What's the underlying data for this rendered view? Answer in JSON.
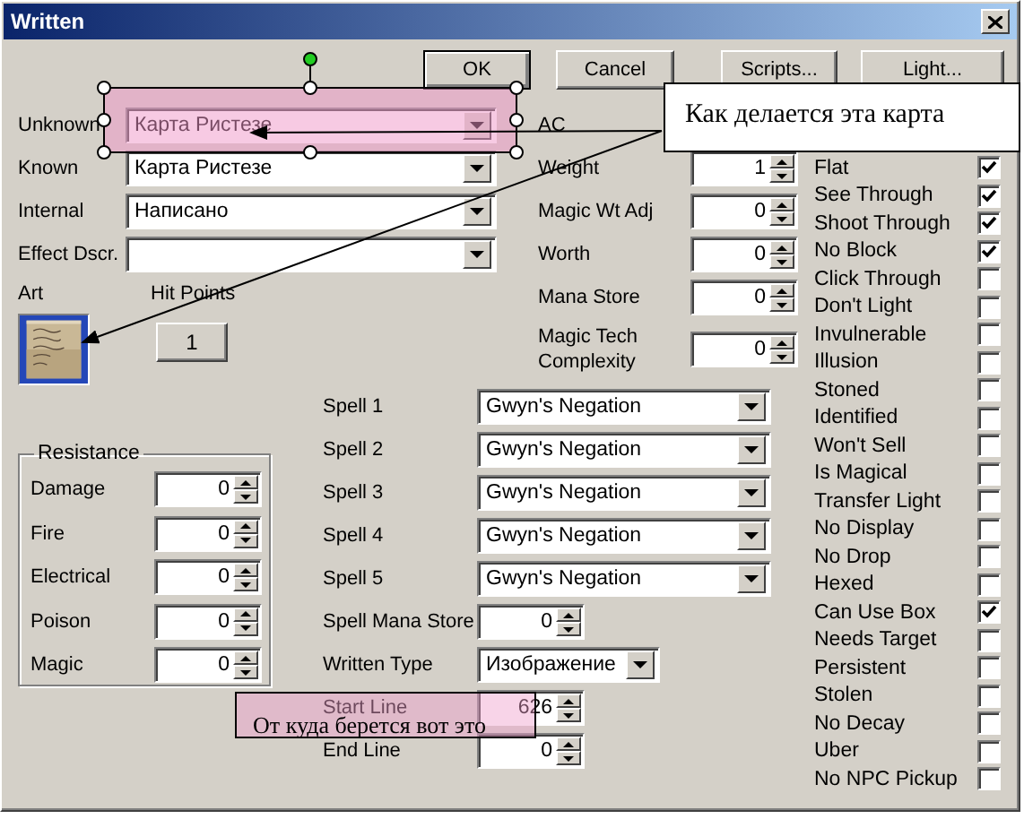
{
  "window": {
    "title": "Written"
  },
  "buttons": [
    {
      "label": "OK",
      "default": true
    },
    {
      "label": "Cancel",
      "default": false
    },
    {
      "label": "Scripts...",
      "default": false
    },
    {
      "label": "Light...",
      "default": false
    }
  ],
  "descriptions": [
    {
      "label": "Unknown",
      "value": "Карта Ристезе"
    },
    {
      "label": "Known",
      "value": "Карта Ристезе"
    },
    {
      "label": "Internal",
      "value": "Написано"
    },
    {
      "label": "Effect Dscr."
    }
  ],
  "art": {
    "label": "Art",
    "kind": "picture"
  },
  "hit_points": {
    "label": "Hit Points",
    "value": "1"
  },
  "stats": [
    {
      "label": "AC"
    },
    {
      "label": "Weight",
      "value": "1"
    },
    {
      "label": "Magic Wt Adj",
      "value": "0"
    },
    {
      "label": "Worth",
      "value": "0"
    },
    {
      "label": "Mana Store",
      "value": "0"
    },
    {
      "label": "Magic Tech Complexity",
      "value": "0"
    }
  ],
  "resistance": {
    "title": "Resistance",
    "rows": [
      {
        "label": "Damage",
        "value": "0"
      },
      {
        "label": "Fire",
        "value": "0"
      },
      {
        "label": "Electrical",
        "value": "0"
      },
      {
        "label": "Poison",
        "value": "0"
      },
      {
        "label": "Magic",
        "value": "0"
      }
    ]
  },
  "spells": [
    {
      "kind": "combo",
      "label": "Spell 1",
      "value": "Gwyn's Negation"
    },
    {
      "kind": "combo",
      "label": "Spell 2",
      "value": "Gwyn's Negation"
    },
    {
      "kind": "combo",
      "label": "Spell 3",
      "value": "Gwyn's Negation"
    },
    {
      "kind": "combo",
      "label": "Spell 4",
      "value": "Gwyn's Negation"
    },
    {
      "kind": "combo",
      "label": "Spell 5",
      "value": "Gwyn's Negation"
    },
    {
      "kind": "spin",
      "label": "Spell Mana Store",
      "value": "0"
    },
    {
      "kind": "combo",
      "label": "Written Type",
      "value": "Изображение"
    },
    {
      "kind": "spin",
      "label": "Start Line",
      "value": "626"
    },
    {
      "kind": "spin",
      "label": "End Line",
      "value": "0"
    }
  ],
  "flags": [
    {
      "label": "Flat",
      "checked": true
    },
    {
      "label": "See Through",
      "checked": true
    },
    {
      "label": "Shoot Through",
      "checked": true
    },
    {
      "label": "No Block",
      "checked": true
    },
    {
      "label": "Click Through",
      "checked": false
    },
    {
      "label": "Don't Light",
      "checked": false
    },
    {
      "label": "Invulnerable",
      "checked": false
    },
    {
      "label": "Illusion",
      "checked": false
    },
    {
      "label": "Stoned",
      "checked": false
    },
    {
      "label": "Identified",
      "checked": false
    },
    {
      "label": "Won't Sell",
      "checked": false
    },
    {
      "label": "Is Magical",
      "checked": false
    },
    {
      "label": "Transfer Light",
      "checked": false
    },
    {
      "label": "No Display",
      "checked": false
    },
    {
      "label": "No Drop",
      "checked": false
    },
    {
      "label": "Hexed",
      "checked": false
    },
    {
      "label": "Can Use Box",
      "checked": true
    },
    {
      "label": "Needs Target",
      "checked": false
    },
    {
      "label": "Persistent",
      "checked": false
    },
    {
      "label": "Stolen",
      "checked": false
    },
    {
      "label": "No Decay",
      "checked": false
    },
    {
      "label": "Uber",
      "checked": false
    },
    {
      "label": "No NPC Pickup",
      "checked": false
    }
  ],
  "annotations": [
    {
      "kind": "callout",
      "text": "Как делается эта карта"
    },
    {
      "kind": "note",
      "text": "От куда берется вот это"
    }
  ]
}
